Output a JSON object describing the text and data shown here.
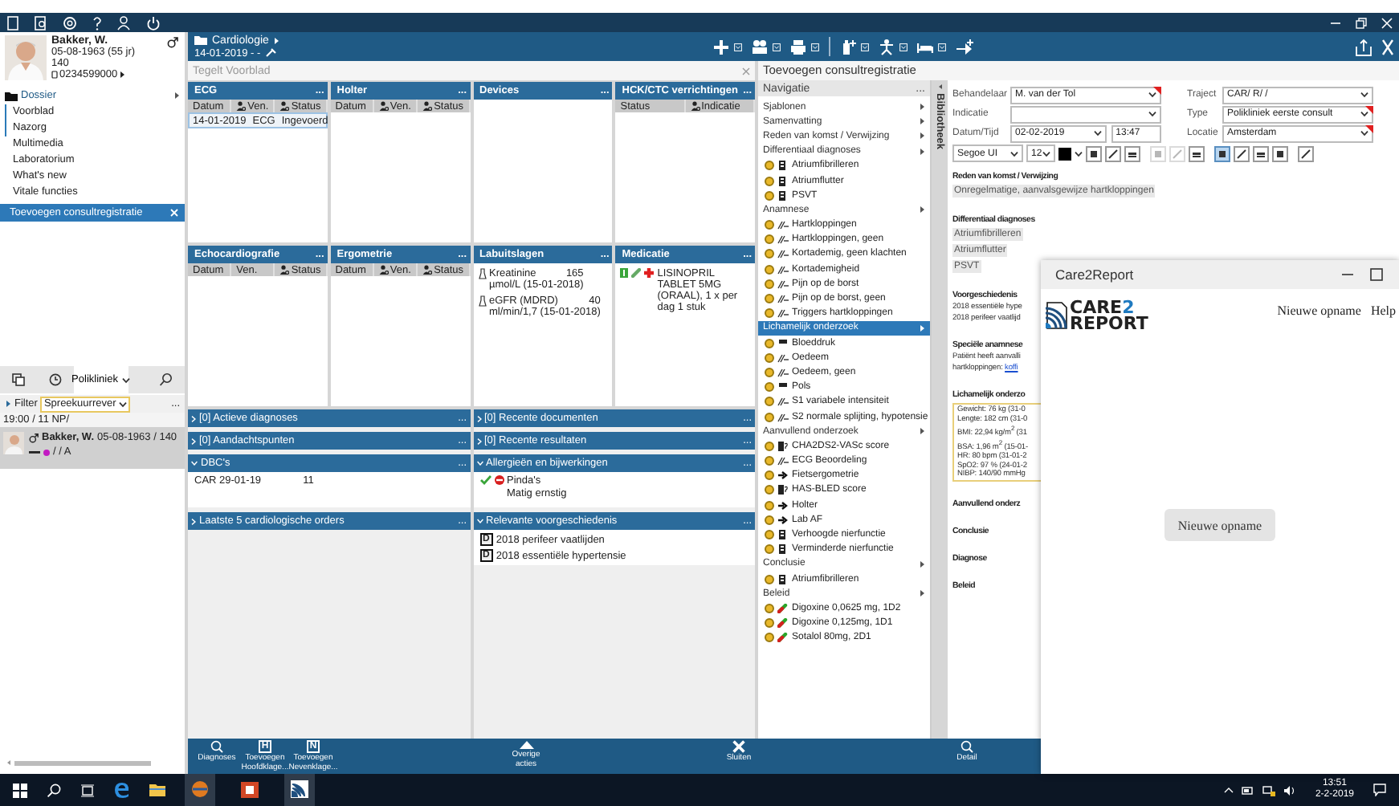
{
  "patient": {
    "name": "Bakker, W.",
    "birth_date": "05-08-1963 (55 jr)",
    "number": "140",
    "phone": "0234599000"
  },
  "sidebar": {
    "section": "Dossier",
    "items": [
      {
        "label": "Voorblad",
        "flagged": true
      },
      {
        "label": "Nazorg",
        "flagged": true
      },
      {
        "label": "Multimedia",
        "flagged": false
      },
      {
        "label": "Laboratorium",
        "flagged": false
      },
      {
        "label": "What's new",
        "flagged": false
      },
      {
        "label": "Vitale functies",
        "flagged": false
      }
    ],
    "open_task": "Toevoegen consultregistratie"
  },
  "worklist": {
    "tabs": [
      {
        "kind": "stack",
        "selected": false
      },
      {
        "kind": "history",
        "selected": false
      },
      {
        "kind": "dropdown",
        "label": "Polikliniek",
        "selected": true
      },
      {
        "kind": "search",
        "selected": false
      }
    ],
    "filter_label": "Filter",
    "filter_value": "Spreekuurrever",
    "filter_menu": "...",
    "slot": "19:00 / 11  NP/",
    "patient": {
      "name": "Bakker, W.",
      "details": "05-08-1963 / 140",
      "status": "/ / A",
      "color": "#c21bc2",
      "selected": true
    }
  },
  "context": {
    "department": "Cardiologie",
    "date": "14-01-2019 -  -",
    "page_title": "Tegelt Voorblad"
  },
  "tiles": [
    {
      "kind": "table",
      "title": "ECG",
      "menu": "...",
      "columns": [
        {
          "label": "Datum",
          "icon": false
        },
        {
          "label": "Ven.",
          "icon": true
        },
        {
          "label": "Status",
          "icon": true
        }
      ],
      "rows": [
        {
          "cells": [
            "14-01-2019",
            "ECG",
            "Ingevoerd"
          ],
          "selected": true
        }
      ]
    },
    {
      "kind": "table",
      "title": "Holter",
      "menu": "...",
      "columns": [
        {
          "label": "Datum",
          "icon": false
        },
        {
          "label": "Ven.",
          "icon": true
        },
        {
          "label": "Status",
          "icon": true
        }
      ]
    },
    {
      "kind": "table",
      "title": "Devices",
      "menu": "..."
    },
    {
      "kind": "table",
      "title": "HCK/CTC verrichtingen",
      "menu": "...",
      "columns": [
        {
          "label": "Status",
          "icon": false
        },
        {
          "label": "Indicatie",
          "icon": true
        }
      ]
    },
    {
      "kind": "table",
      "title": "Echocardiografie",
      "menu": "...",
      "columns": [
        {
          "label": "Datum",
          "icon": false
        },
        {
          "label": "Ven.",
          "icon": false
        },
        {
          "label": "Status",
          "icon": true
        }
      ]
    },
    {
      "kind": "table",
      "title": "Ergometrie",
      "menu": "...",
      "columns": [
        {
          "label": "Datum",
          "icon": false
        },
        {
          "label": "Ven.",
          "icon": true
        },
        {
          "label": "Status",
          "icon": true
        }
      ]
    },
    {
      "kind": "lab",
      "title": "Labuitslagen",
      "menu": "...",
      "results": [
        {
          "name": "Kreatinine",
          "value": "165",
          "detail": "µmol/L    (15-01-2018)"
        },
        {
          "name": "eGFR (MDRD)",
          "value": "40",
          "detail": "ml/min/1,7 (15-01-2018)"
        }
      ]
    },
    {
      "kind": "medication",
      "title": "Medicatie",
      "menu": "...",
      "items": [
        {
          "text": "LISINOPRIL TABLET 5MG (ORAAL), 1 x per dag 1 stuk"
        }
      ]
    }
  ],
  "sections": {
    "left": [
      {
        "kind": "plain",
        "title": "[0] Actieve diagnoses",
        "menu": "...",
        "expanded": false
      },
      {
        "kind": "plain",
        "title": "[0] Aandachtspunten",
        "menu": "...",
        "expanded": false
      },
      {
        "kind": "dbc",
        "title": "DBC's",
        "menu": "...",
        "expanded": true,
        "rows": [
          {
            "code": "CAR 29-01-19",
            "value": "11"
          }
        ]
      },
      {
        "kind": "plain",
        "title": "Laatste 5 cardiologische orders",
        "menu": "...",
        "expanded": false
      }
    ],
    "right": [
      {
        "kind": "plain",
        "title": "[0] Recente documenten",
        "menu": "...",
        "expanded": false
      },
      {
        "kind": "plain",
        "title": "[0] Recente resultaten",
        "menu": "...",
        "expanded": false
      },
      {
        "kind": "allergy",
        "title": "Allergieën en bijwerkingen",
        "menu": "...",
        "expanded": true,
        "items": [
          {
            "name": "Pinda's",
            "severity": "Matig ernstig"
          }
        ]
      },
      {
        "kind": "history",
        "title": "Relevante voorgeschiedenis",
        "menu": "...",
        "expanded": true,
        "items": [
          {
            "badge": "D",
            "text": "2018 perifeer vaatlijden"
          },
          {
            "badge": "D",
            "text": "2018 essentiële hypertensie"
          }
        ]
      }
    ]
  },
  "dashboard_actions": [
    {
      "kind": "search",
      "label": "Diagnoses"
    },
    {
      "kind": "letter",
      "badge": "H",
      "label": "Toevoegen Hoofdklage..."
    },
    {
      "kind": "letter",
      "badge": "N",
      "label": "Toevoegen Nevenklage..."
    },
    {
      "kind": "more",
      "label": "Overige acties"
    },
    {
      "kind": "close",
      "label": "Sluiten"
    }
  ],
  "consult_actions": [
    {
      "kind": "search",
      "label": "Detail"
    }
  ],
  "consult": {
    "title": "Toevoegen consultregistratie",
    "navigation_title": "Navigatie",
    "navigation_menu": "...",
    "library_tab": "Bibliotheek",
    "navigation": [
      {
        "label": "Sjablonen",
        "selected": false
      },
      {
        "label": "Samenvatting",
        "selected": false
      },
      {
        "label": "Reden van komst / Verwijzing",
        "selected": false
      },
      {
        "label": "Differentiaal diagnoses",
        "selected": false,
        "children": [
          {
            "kind": "diagnosis",
            "label": "Atriumfibrilleren"
          },
          {
            "kind": "diagnosis",
            "label": "Atriumflutter"
          },
          {
            "kind": "diagnosis",
            "label": "PSVT"
          }
        ]
      },
      {
        "label": "Anamnese",
        "selected": false,
        "children": [
          {
            "kind": "finding",
            "label": "Hartkloppingen"
          },
          {
            "kind": "finding",
            "label": "Hartkloppingen, geen"
          },
          {
            "kind": "finding",
            "label": "Kortademig, geen klachten"
          },
          {
            "kind": "finding",
            "label": "Kortademigheid"
          },
          {
            "kind": "finding",
            "label": "Pijn op de borst"
          },
          {
            "kind": "finding",
            "label": "Pijn op de borst, geen"
          },
          {
            "kind": "finding",
            "label": "Triggers hartkloppingen"
          }
        ]
      },
      {
        "label": "Lichamelijk onderzoek",
        "selected": true,
        "children": [
          {
            "kind": "measure",
            "label": "Bloeddruk"
          },
          {
            "kind": "finding",
            "label": "Oedeem"
          },
          {
            "kind": "finding",
            "label": "Oedeem, geen"
          },
          {
            "kind": "measure",
            "label": "Pols"
          },
          {
            "kind": "finding",
            "label": "S1 variabele intensiteit"
          },
          {
            "kind": "finding",
            "label": "S2 normale splijting, hypotensie"
          }
        ]
      },
      {
        "label": "Aanvullend onderzoek",
        "selected": false,
        "children": [
          {
            "kind": "score",
            "label": "CHA2DS2-VASc score"
          },
          {
            "kind": "finding",
            "label": "ECG Beoordeling"
          },
          {
            "kind": "order",
            "label": "Fietsergometrie"
          },
          {
            "kind": "score",
            "label": "HAS-BLED score"
          },
          {
            "kind": "order",
            "label": "Holter"
          },
          {
            "kind": "order",
            "label": "Lab AF"
          },
          {
            "kind": "diagnosis",
            "label": "Verhoogde nierfunctie"
          },
          {
            "kind": "diagnosis",
            "label": "Verminderde nierfunctie"
          }
        ]
      },
      {
        "label": "Conclusie",
        "selected": false,
        "children": [
          {
            "kind": "diagnosis",
            "label": "Atriumfibrilleren"
          }
        ]
      },
      {
        "label": "Beleid",
        "selected": false,
        "children": [
          {
            "kind": "drug",
            "label": "Digoxine 0,0625 mg, 1D2"
          },
          {
            "kind": "drug",
            "label": "Digoxine 0,125mg, 1D1"
          },
          {
            "kind": "drug",
            "label": "Sotalol 80mg, 2D1"
          }
        ]
      }
    ],
    "fields": [
      {
        "label": "Behandelaar",
        "kind": "select",
        "value": "M. van der Tol",
        "required": true
      },
      {
        "label": "Traject",
        "kind": "select",
        "value": "CAR/ R/ /",
        "required": false
      },
      {
        "label": "Indicatie",
        "kind": "select",
        "required": false
      },
      {
        "label": "Type",
        "kind": "select",
        "value": "Polikliniek eerste consult",
        "required": true
      },
      {
        "label": "Datum/Tijd",
        "kind": "date",
        "value": "02-02-2019",
        "time": "13:47",
        "required": false
      },
      {
        "label": "Locatie",
        "kind": "select",
        "value": "Amsterdam",
        "required": true
      }
    ],
    "font": "Segoe UI",
    "font_size": "12",
    "format_buttons": [
      {
        "selected": false,
        "disabled": false
      },
      {
        "selected": false,
        "disabled": false
      },
      {
        "selected": false,
        "disabled": false
      },
      {
        "selected": false,
        "disabled": true
      },
      {
        "selected": false,
        "disabled": true
      },
      {
        "selected": false,
        "disabled": false
      },
      {
        "selected": true,
        "disabled": false
      },
      {
        "selected": false,
        "disabled": false
      },
      {
        "selected": false,
        "disabled": false
      },
      {
        "selected": false,
        "disabled": false
      },
      {
        "selected": false,
        "disabled": false
      }
    ],
    "document": [
      {
        "kind": "chips",
        "heading": "Reden van komst / Verwijzing",
        "lines": [
          "Onregelmatige, aanvalsgewijze hartkloppingen"
        ]
      },
      {
        "kind": "chips",
        "heading": "Differentiaal diagnoses",
        "lines": [
          "Atriumfibrilleren",
          "Atriumflutter",
          "PSVT"
        ]
      },
      {
        "kind": "text",
        "heading": "Voorgeschiedenis",
        "lines": [
          "2018 essentiële hype",
          "2018 perifeer vaatlijd"
        ]
      },
      {
        "kind": "text",
        "heading": "Speciële anamnese",
        "lines": [
          "Patiënt heeft aanvalli"
        ],
        "link_prefix": "hartkloppingen: ",
        "link": "koffi"
      },
      {
        "kind": "box",
        "heading": "Lichamelijk onderzo",
        "lines": [
          "Gewicht: 76 kg (31-0",
          "Lengte: 182 cm (31-0",
          "BMI: 22,94 kg/m$^{2}$ (31",
          "BSA: 1,96 m$^{2}$ (15-01-",
          "HR: 80 bpm (31-01-2",
          "SpO2: 97 % (24-01-2",
          "NIBP: 140/90 mmHg"
        ]
      },
      {
        "kind": "text",
        "heading": "Aanvullend onderz"
      },
      {
        "kind": "text",
        "heading": "Conclusie"
      },
      {
        "kind": "text",
        "heading": "Diagnose"
      },
      {
        "kind": "text",
        "heading": "Beleid"
      }
    ]
  },
  "popup": {
    "title": "Care2Report",
    "logo_word": "CARE",
    "logo_accent": "2",
    "logo_second": "REPORT",
    "menu": [
      "Nieuwe opname",
      "Help"
    ],
    "button": "Nieuwe opname"
  },
  "taskbar": {
    "time": "13:51",
    "date": "2-2-2019"
  }
}
